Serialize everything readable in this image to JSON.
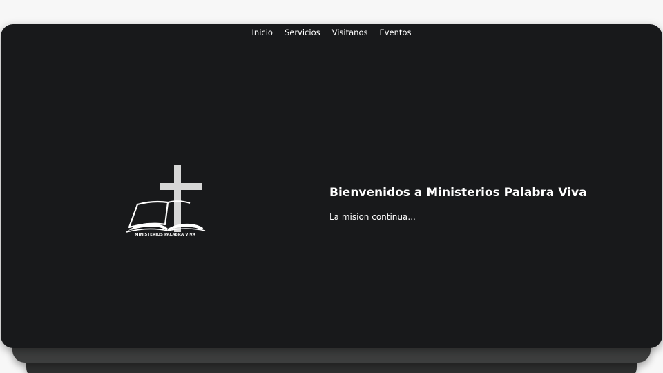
{
  "nav": {
    "items": [
      {
        "label": "Inicio"
      },
      {
        "label": "Servicios"
      },
      {
        "label": "Visitanos"
      },
      {
        "label": "Eventos"
      }
    ]
  },
  "logo": {
    "text": "MINISTERIOS PALABRA VIVA",
    "icon": "cross-bible-icon"
  },
  "hero": {
    "title": "Bienvenidos a Ministerios Palabra Viva",
    "subtitle": "La mision continua..."
  },
  "colors": {
    "hero_background": "#18191b",
    "text": "#ffffff",
    "page_background": "#f7f7f7"
  }
}
